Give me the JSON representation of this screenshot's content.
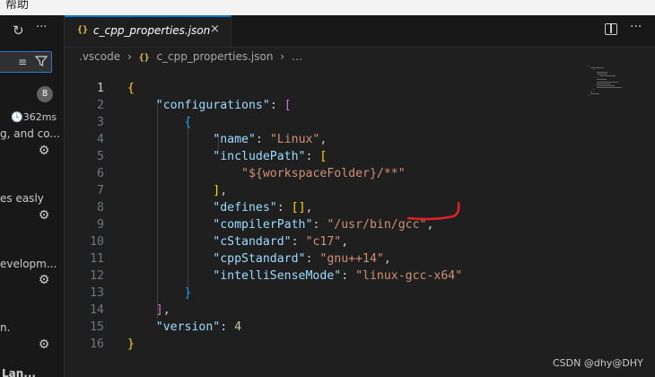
{
  "menubar": {
    "label": "帮助"
  },
  "sidebar": {
    "refresh_icon": "↻",
    "more_icon": "···",
    "filter_icons": [
      "clear-filter",
      "filter"
    ],
    "badge": "8",
    "timing": "362ms",
    "items": [
      {
        "text": "g, and co..."
      },
      {
        "text": "es easly"
      },
      {
        "text": "evelopm..."
      },
      {
        "text": "n."
      },
      {
        "text": "Lan..."
      }
    ]
  },
  "tab": {
    "icon": "{}",
    "label": "c_cpp_properties.json",
    "close": "×"
  },
  "breadcrumb": {
    "folder": ".vscode",
    "sep": "›",
    "icon": "{}",
    "file": "c_cpp_properties.json",
    "more": "…"
  },
  "code_lines": [
    {
      "n": "1",
      "tokens": [
        {
          "c": "b1",
          "t": "{"
        }
      ]
    },
    {
      "n": "2",
      "tokens": [
        {
          "c": "txt",
          "t": "    "
        },
        {
          "c": "key",
          "t": "\"configurations\""
        },
        {
          "c": "txt",
          "t": ": "
        },
        {
          "c": "b2",
          "t": "["
        }
      ]
    },
    {
      "n": "3",
      "tokens": [
        {
          "c": "txt",
          "t": "        "
        },
        {
          "c": "b3",
          "t": "{"
        }
      ]
    },
    {
      "n": "4",
      "tokens": [
        {
          "c": "txt",
          "t": "            "
        },
        {
          "c": "key",
          "t": "\"name\""
        },
        {
          "c": "txt",
          "t": ": "
        },
        {
          "c": "str",
          "t": "\"Linux\""
        },
        {
          "c": "txt",
          "t": ","
        }
      ]
    },
    {
      "n": "5",
      "tokens": [
        {
          "c": "txt",
          "t": "            "
        },
        {
          "c": "key",
          "t": "\"includePath\""
        },
        {
          "c": "txt",
          "t": ": "
        },
        {
          "c": "b1",
          "t": "["
        }
      ]
    },
    {
      "n": "6",
      "tokens": [
        {
          "c": "txt",
          "t": "                "
        },
        {
          "c": "str",
          "t": "\"${workspaceFolder}/**\""
        }
      ]
    },
    {
      "n": "7",
      "tokens": [
        {
          "c": "txt",
          "t": "            "
        },
        {
          "c": "b1",
          "t": "]"
        },
        {
          "c": "txt",
          "t": ","
        }
      ]
    },
    {
      "n": "8",
      "tokens": [
        {
          "c": "txt",
          "t": "            "
        },
        {
          "c": "key",
          "t": "\"defines\""
        },
        {
          "c": "txt",
          "t": ": "
        },
        {
          "c": "b1",
          "t": "[]"
        },
        {
          "c": "txt",
          "t": ","
        }
      ]
    },
    {
      "n": "9",
      "tokens": [
        {
          "c": "txt",
          "t": "            "
        },
        {
          "c": "key",
          "t": "\"compilerPath\""
        },
        {
          "c": "txt",
          "t": ": "
        },
        {
          "c": "str",
          "t": "\"/usr/bin/gcc\""
        },
        {
          "c": "txt",
          "t": ","
        }
      ]
    },
    {
      "n": "10",
      "tokens": [
        {
          "c": "txt",
          "t": "            "
        },
        {
          "c": "key",
          "t": "\"cStandard\""
        },
        {
          "c": "txt",
          "t": ": "
        },
        {
          "c": "str",
          "t": "\"c17\""
        },
        {
          "c": "txt",
          "t": ","
        }
      ]
    },
    {
      "n": "11",
      "tokens": [
        {
          "c": "txt",
          "t": "            "
        },
        {
          "c": "key",
          "t": "\"cppStandard\""
        },
        {
          "c": "txt",
          "t": ": "
        },
        {
          "c": "str",
          "t": "\"gnu++14\""
        },
        {
          "c": "txt",
          "t": ","
        }
      ]
    },
    {
      "n": "12",
      "tokens": [
        {
          "c": "txt",
          "t": "            "
        },
        {
          "c": "key",
          "t": "\"intelliSenseMode\""
        },
        {
          "c": "txt",
          "t": ": "
        },
        {
          "c": "str",
          "t": "\"linux-gcc-x64\""
        }
      ]
    },
    {
      "n": "13",
      "tokens": [
        {
          "c": "txt",
          "t": "        "
        },
        {
          "c": "b3",
          "t": "}"
        }
      ]
    },
    {
      "n": "14",
      "tokens": [
        {
          "c": "txt",
          "t": "    "
        },
        {
          "c": "b2",
          "t": "]"
        },
        {
          "c": "txt",
          "t": ","
        }
      ]
    },
    {
      "n": "15",
      "tokens": [
        {
          "c": "txt",
          "t": "    "
        },
        {
          "c": "key",
          "t": "\"version\""
        },
        {
          "c": "txt",
          "t": ": "
        },
        {
          "c": "num",
          "t": "4"
        }
      ]
    },
    {
      "n": "16",
      "tokens": [
        {
          "c": "b1",
          "t": "}"
        }
      ]
    }
  ],
  "watermark": "CSDN @dhy@DHY",
  "colors": {
    "accent": "#0078d4",
    "annotation": "#e0202a",
    "string": "#ce9178",
    "key": "#9cdcfe"
  }
}
